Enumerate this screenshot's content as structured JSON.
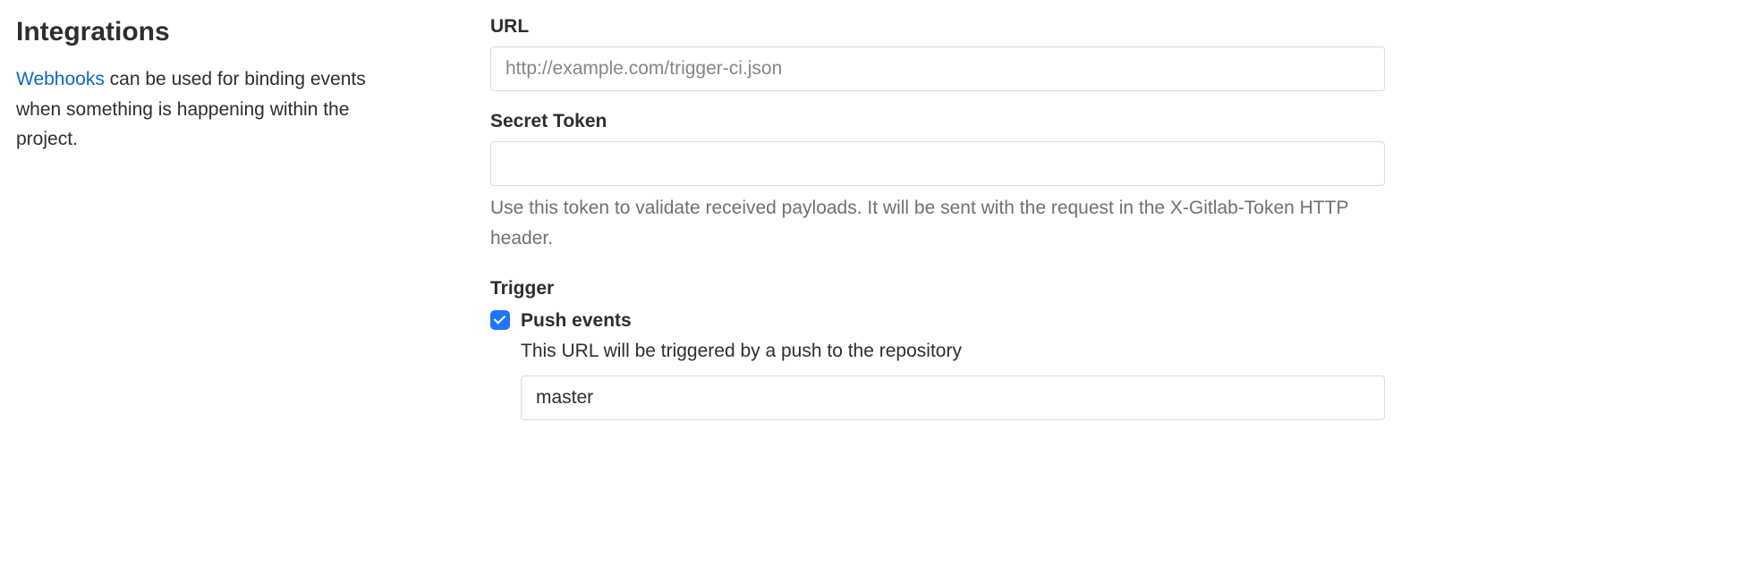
{
  "left": {
    "title": "Integrations",
    "link_text": "Webhooks",
    "description_rest": " can be used for binding events when something is happening within the project."
  },
  "form": {
    "url": {
      "label": "URL",
      "placeholder": "http://example.com/trigger-ci.json",
      "value": ""
    },
    "secret_token": {
      "label": "Secret Token",
      "value": "",
      "help": "Use this token to validate received payloads. It will be sent with the request in the X-Gitlab-Token HTTP header."
    },
    "trigger": {
      "label": "Trigger",
      "push_events": {
        "checked": true,
        "title": "Push events",
        "description": "This URL will be triggered by a push to the repository",
        "branch_value": "master"
      }
    }
  }
}
